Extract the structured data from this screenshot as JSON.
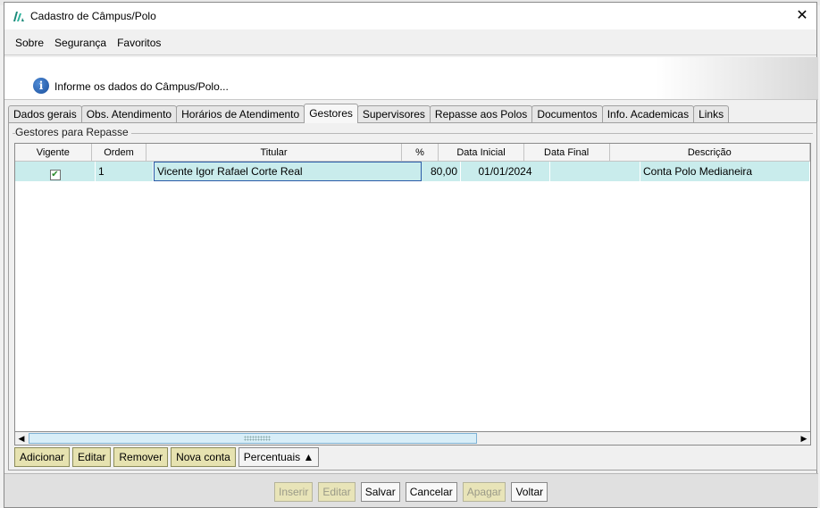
{
  "window": {
    "title": "Cadastro de Câmpus/Polo",
    "close_symbol": "✕"
  },
  "menu": {
    "items": [
      "Sobre",
      "Segurança",
      "Favoritos"
    ]
  },
  "info": {
    "icon": "info-icon",
    "text": "Informe os dados do Câmpus/Polo..."
  },
  "tabs": [
    "Dados gerais",
    "Obs. Atendimento",
    "Horários de Atendimento",
    "Gestores",
    "Supervisores",
    "Repasse aos Polos",
    "Documentos",
    "Info. Academicas",
    "Links"
  ],
  "active_tab": "Gestores",
  "group": {
    "title": "Gestores para Repasse"
  },
  "grid": {
    "columns": [
      "Vigente",
      "Ordem",
      "Titular",
      "%",
      "Data Inicial",
      "Data Final",
      "Descrição"
    ],
    "rows": [
      {
        "vigente": "✔",
        "ordem": "1",
        "titular": "Vicente Igor Rafael Corte Real",
        "percent": "80,00",
        "data_inicial": "01/01/2024",
        "data_final": "",
        "descricao": "Conta Polo Medianeira"
      }
    ],
    "scroll_left": "◀",
    "scroll_right": "▶"
  },
  "actions": {
    "adicionar": "Adicionar",
    "editar": "Editar",
    "remover": "Remover",
    "nova_conta": "Nova conta",
    "percentuais": "Percentuais ▲"
  },
  "footer": {
    "inserir": "Inserir",
    "editar": "Editar",
    "salvar": "Salvar",
    "cancelar": "Cancelar",
    "apagar": "Apagar",
    "voltar": "Voltar"
  }
}
